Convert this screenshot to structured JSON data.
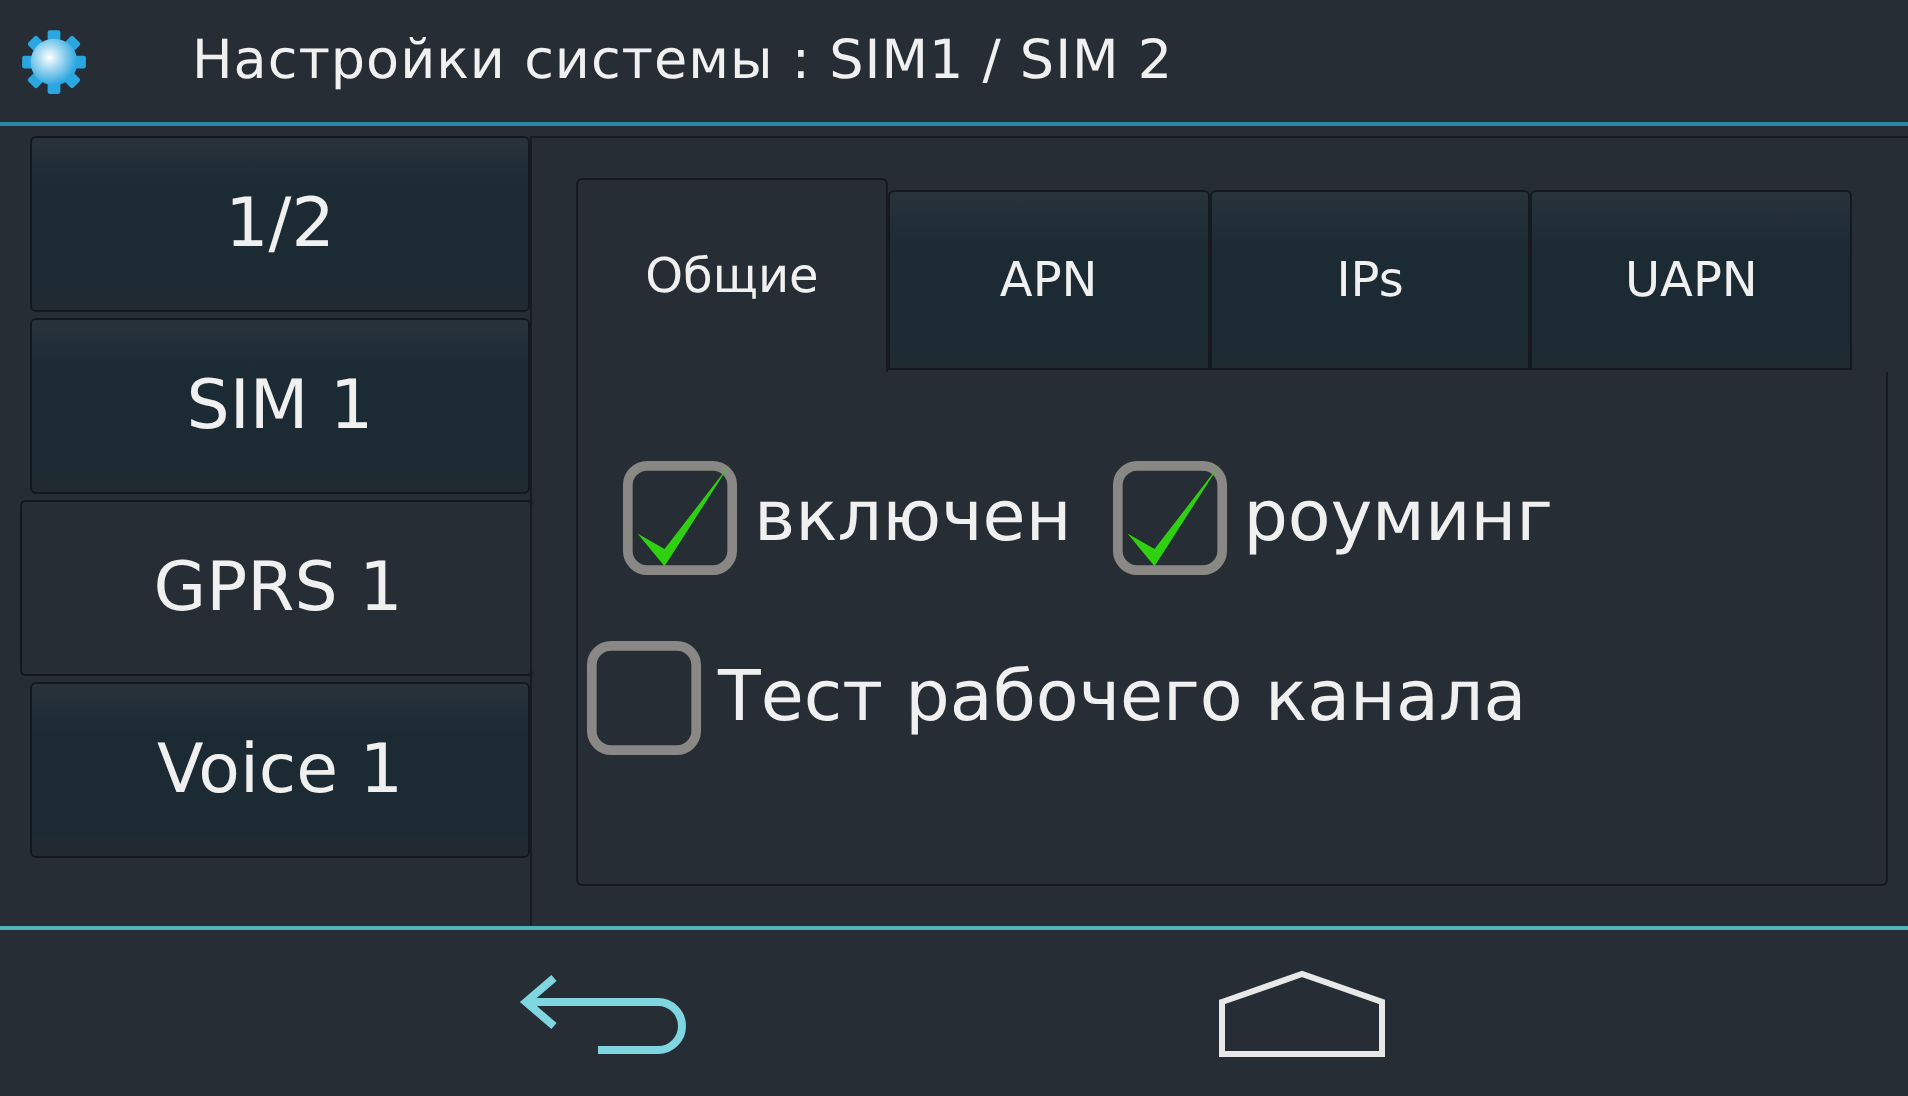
{
  "title": "Настройки системы : SIM1 / SIM 2",
  "side_tabs": [
    {
      "label": "1/2",
      "selected": false
    },
    {
      "label": "SIM 1",
      "selected": false
    },
    {
      "label": "GPRS 1",
      "selected": true
    },
    {
      "label": "Voice 1",
      "selected": false
    }
  ],
  "tabs": [
    {
      "label": "Общие",
      "selected": true
    },
    {
      "label": "APN",
      "selected": false
    },
    {
      "label": "IPs",
      "selected": false
    },
    {
      "label": "UAPN",
      "selected": false
    }
  ],
  "options": [
    {
      "label": "включен",
      "checked": true
    },
    {
      "label": "роуминг",
      "checked": true
    },
    {
      "label": "Тест рабочего канала",
      "checked": false
    }
  ],
  "nav_buttons": [
    {
      "kind": "back"
    },
    {
      "kind": "home"
    }
  ]
}
